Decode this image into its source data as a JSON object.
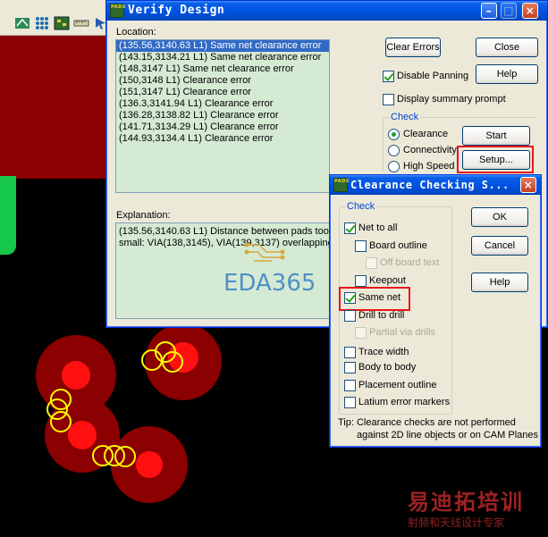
{
  "colors": {
    "canvas_bg": "#000000",
    "pad_dark": "#8b0000",
    "pad_bright": "#ff1010",
    "error_marker": "#ffff00",
    "list_bg": "#d4ead3",
    "highlight": "#e8151b",
    "group_title": "#0046d5"
  },
  "verify": {
    "title": "Verify Design",
    "icon_text": "PADS",
    "location_label": "Location:",
    "locations": [
      "(135.56,3140.63 L1) Same net clearance error",
      "(143.15,3134.21 L1) Same net clearance error",
      "(148,3147 L1) Same net clearance error",
      "(150,3148 L1) Clearance error",
      "(151,3147 L1) Clearance error",
      "(136.3,3141.94 L1) Clearance error",
      "(136.28,3138.82 L1) Clearance error",
      "(141.71,3134.29 L1) Clearance error",
      "(144.93,3134.4 L1) Clearance error"
    ],
    "explanation_label": "Explanation:",
    "explanation_line1": "(135.56,3140.63 L1) Distance between pads too",
    "explanation_line2": "small: VIA(138,3145), VIA(139,3137) overlapping",
    "watermark": "EDA365",
    "clear_errors": "Clear Errors",
    "close": "Close",
    "disable_panning": "Disable Panning",
    "help": "Help",
    "display_summary": "Display summary prompt",
    "check_group": "Check",
    "clearance": "Clearance",
    "connectivity": "Connectivity",
    "high_speed": "High Speed",
    "start": "Start",
    "setup": "Setup...",
    "disable_panning_checked": true,
    "display_summary_checked": false,
    "selected_check": "clearance"
  },
  "clearance": {
    "title": "Clearance Checking S...",
    "icon_text": "PADS",
    "check_group": "Check",
    "net_to_all": "Net to all",
    "board_outline": "Board outline",
    "off_board_text": "Off board text",
    "keepout": "Keepout",
    "same_net": "Same net",
    "drill_to_drill": "Drill to drill",
    "partial_via_drills": "Partial via drills",
    "trace_width": "Trace width",
    "body_to_body": "Body to body",
    "placement_outline": "Placement outline",
    "latium_error_markers": "Latium error markers",
    "ok": "OK",
    "cancel": "Cancel",
    "help": "Help",
    "tip_line1": "Tip: Clearance checks are not performed",
    "tip_line2": "against 2D line objects or on CAM Planes",
    "net_to_all_checked": true,
    "same_net_checked": true
  },
  "watermark_cn": {
    "line1": "易迪拓培训",
    "line2": "射频和天线设计专家"
  }
}
